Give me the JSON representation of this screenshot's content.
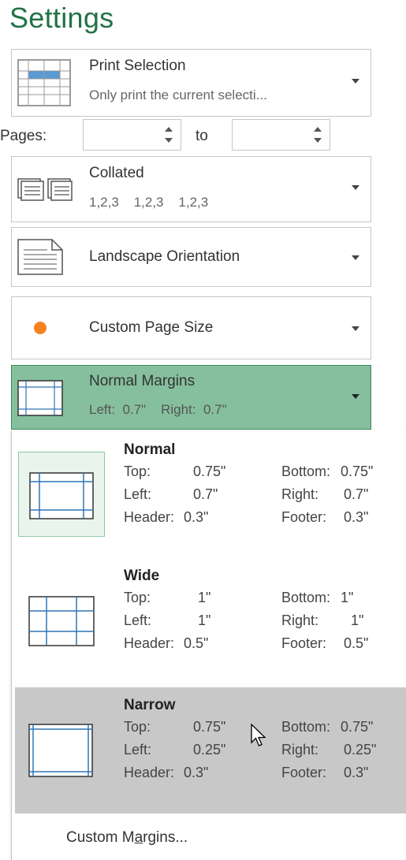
{
  "header": {
    "title": "Settings"
  },
  "print_what": {
    "title": "Print Selection",
    "subtitle": "Only print the current selecti..."
  },
  "pages": {
    "label": "Pages:",
    "from_value": "",
    "to_label": "to",
    "to_value": ""
  },
  "collation": {
    "title": "Collated",
    "subtitle": "1,2,3    1,2,3    1,2,3"
  },
  "orientation": {
    "title": "Landscape Orientation"
  },
  "page_size": {
    "title": "Custom Page Size",
    "icon_color": "#f58220"
  },
  "margins": {
    "title": "Normal Margins",
    "subtitle": "Left:  0.7\"    Right:  0.7\"",
    "accent": "#86bf9d"
  },
  "margin_options": [
    {
      "name": "Normal",
      "top_label": "Top:",
      "top": "0.75\"",
      "bottom_label": "Bottom:",
      "bottom": "0.75\"",
      "left_label": "Left:",
      "left": "0.7\"",
      "right_label": "Right:",
      "right": "0.7\"",
      "header_label": "Header:",
      "header": "0.3\"",
      "footer_label": "Footer:",
      "footer": "0.3\"",
      "state": "selected"
    },
    {
      "name": "Wide",
      "top_label": "Top:",
      "top": "1\"",
      "bottom_label": "Bottom:",
      "bottom": "1\"",
      "left_label": "Left:",
      "left": "1\"",
      "right_label": "Right:",
      "right": "1\"",
      "header_label": "Header:",
      "header": "0.5\"",
      "footer_label": "Footer:",
      "footer": "0.5\"",
      "state": "normal"
    },
    {
      "name": "Narrow",
      "top_label": "Top:",
      "top": "0.75\"",
      "bottom_label": "Bottom:",
      "bottom": "0.75\"",
      "left_label": "Left:",
      "left": "0.25\"",
      "right_label": "Right:",
      "right": "0.25\"",
      "header_label": "Header:",
      "header": "0.3\"",
      "footer_label": "Footer:",
      "footer": "0.3\"",
      "state": "hover"
    }
  ],
  "custom_margins": {
    "label_pre": "Custom M",
    "label_accel": "a",
    "label_post": "rgins..."
  }
}
